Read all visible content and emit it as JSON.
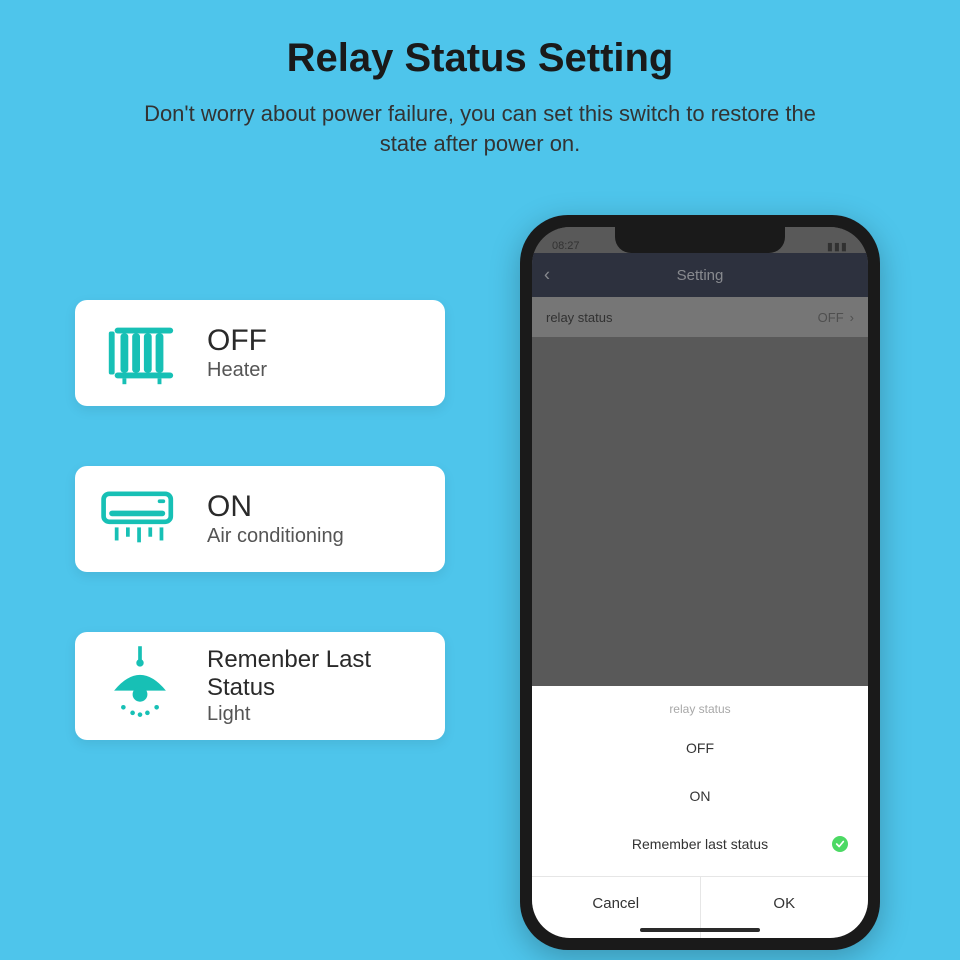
{
  "header": {
    "title": "Relay Status Setting",
    "subtitle": "Don't worry about power failure, you can set this switch to restore the state after power on."
  },
  "cards": [
    {
      "big": "OFF",
      "small": "Heater"
    },
    {
      "big": "ON",
      "small": "Air conditioning"
    },
    {
      "big": "Remenber Last Status",
      "small": "Light"
    }
  ],
  "phone": {
    "time": "08:27",
    "nav_title": "Setting",
    "row": {
      "label": "relay status",
      "value": "OFF"
    },
    "sheet": {
      "title": "relay status",
      "options": [
        "OFF",
        "ON",
        "Remember last status"
      ],
      "selected_index": 2,
      "cancel": "Cancel",
      "ok": "OK"
    }
  },
  "colors": {
    "accent": "#17c0b5",
    "bg": "#4ec5eb"
  }
}
